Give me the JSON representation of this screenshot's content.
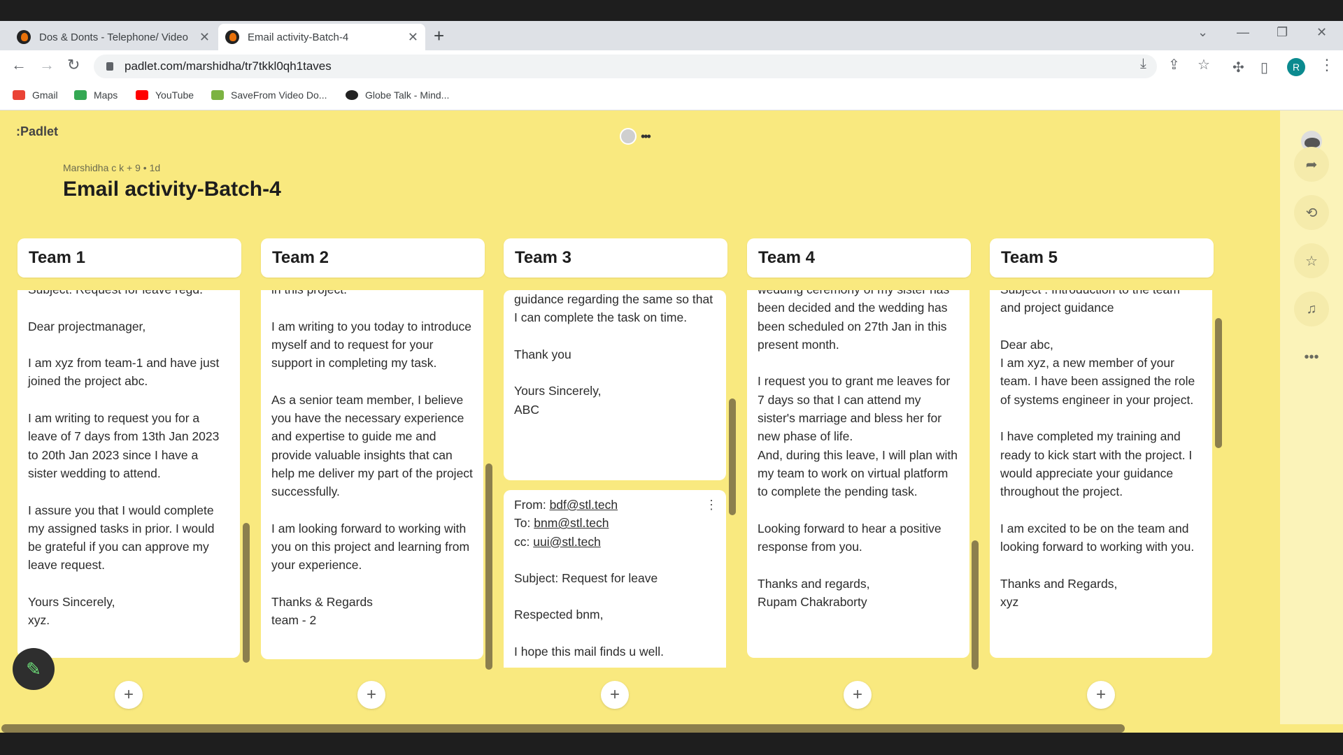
{
  "browser": {
    "tabs": [
      {
        "title": "Dos & Donts - Telephone/ Video"
      },
      {
        "title": "Email activity-Batch-4"
      }
    ],
    "url": "padlet.com/marshidha/tr7tkkl0qh1taves",
    "bookmarks": [
      {
        "label": "Gmail",
        "color": "#ea4335"
      },
      {
        "label": "Maps",
        "color": "#34a853"
      },
      {
        "label": "YouTube",
        "color": "#ff0000"
      },
      {
        "label": "SaveFrom Video Do...",
        "color": "#7cb342"
      },
      {
        "label": "Globe Talk - Mind...",
        "color": "#222222"
      }
    ],
    "profile_initial": "R"
  },
  "padlet": {
    "logo": ":Padlet",
    "meta": "Marshidha c k + 9 • 1d",
    "title": "Email activity-Batch-4",
    "columns": [
      {
        "name": "Team 1",
        "cards": [
          {
            "text": "Subject: Request for leave regd.\n\nDear projectmanager,\n\nI am xyz from team-1 and have just joined the project abc.\n\nI am writing to request you for a leave of 7 days from 13th Jan 2023 to 20th Jan 2023 since I have a sister wedding to attend.\n\nI assure you that I would complete my assigned tasks in prior. I would be grateful if you can approve my leave request.\n\nYours Sincerely,\nxyz."
          }
        ]
      },
      {
        "name": "Team 2",
        "cards": [
          {
            "text": "in this project.\n\nI am writing to you today to introduce myself and to request for your support in completing my task.\n\nAs a senior team member, I believe you have the necessary experience and expertise to guide me and provide valuable insights that can help me deliver my part of the project successfully.\n\nI am looking forward to working with you on this project and learning from your experience.\n\nThanks & Regards\nteam - 2"
          }
        ]
      },
      {
        "name": "Team 3",
        "cards": [
          {
            "text": "guidance regarding the same so that I can complete the task on time.\n\nThank you\n\nYours Sincerely,\nABC"
          },
          {
            "from_label": "From:",
            "from": "bdf@stl.tech",
            "to_label": "To:",
            "to": "bnm@stl.tech",
            "cc_label": "cc:",
            "cc": "uui@stl.tech",
            "text": "Subject: Request for leave\n\nRespected bnm,\n\nI hope this mail finds u well."
          }
        ]
      },
      {
        "name": "Team 4",
        "cards": [
          {
            "text": "wedding ceremony of my sister has been decided and the wedding has been scheduled on 27th Jan in this present month.\n\nI request you to grant me leaves for 7 days so that I can attend my sister's marriage and bless her for new phase of life.\nAnd, during this leave, I will plan with my team to work on virtual platform to complete the pending task.\n\nLooking forward to hear a positive response from you.\n\nThanks and regards,\nRupam Chakraborty"
          }
        ]
      },
      {
        "name": "Team 5",
        "cards": [
          {
            "text": "Subject : Introduction to the team and project guidance\n\nDear abc,\nI am xyz, a new member of your team. I have been assigned the role of systems engineer in your project.\n\n I have completed my training and ready to kick start with the project. I would appreciate your guidance throughout the project.\n\n I am excited to be on the team and looking forward to working with you.\n\nThanks and Regards,\nxyz"
          }
        ]
      }
    ],
    "add_label": "+"
  }
}
